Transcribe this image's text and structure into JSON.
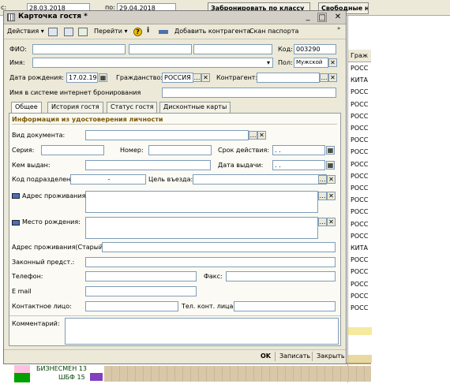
{
  "background": {
    "date_from_label": "с:",
    "date_from": "28.03.2018",
    "date_to_label": "по:",
    "date_to": "29.04.2018",
    "reserve_button": "Забронировать по классу",
    "free_button": "Свободные н",
    "column_header": "Граж",
    "column_values": [
      "РОСС",
      "КИТА",
      "РОСС",
      "РОСС",
      "РОСС",
      "РОСС",
      "РОСС",
      "РОСС",
      "РОСС",
      "РОСС",
      "РОСС",
      "РОСС",
      "РОСС",
      "РОСС",
      "РОСС",
      "КИТА",
      "РОСС",
      "РОСС",
      "РОСС",
      "РОСС",
      "РОСС"
    ],
    "row_businessman": "БИЗНЕСМЕН 13",
    "row_shf": "ШБФ 15"
  },
  "dialog": {
    "title": "Карточка гостя *",
    "toolbar": {
      "actions": "Действия",
      "goto": "Перейти",
      "add_counterparty": "Добавить контрагента",
      "scan_passport": "Скан паспорта"
    },
    "header": {
      "fio_label": "ФИО:",
      "code_label": "Код:",
      "code_value": "003290",
      "name_label": "Имя:",
      "gender_label": "Пол:",
      "gender_value": "Мужской",
      "birth_label": "Дата рождения:",
      "birth_value": "17.02.1965",
      "citizenship_label": "Гражданство:",
      "citizenship_value": "РОССИЯ",
      "counterparty_label": "Контрагент:",
      "internet_label": "Имя в системе интернет бронирования"
    },
    "tabs": [
      "Общее",
      "История гостя",
      "Статус гостя",
      "Дисконтные карты"
    ],
    "general": {
      "section_title": "Информация из удостоверения личности",
      "doc_type_label": "Вид документа:",
      "series_label": "Серия:",
      "number_label": "Номер:",
      "validity_label": "Срок действия:",
      "validity_value": ". .",
      "issued_by_label": "Кем выдан:",
      "issue_date_label": "Дата выдачи:",
      "issue_date_value": ". .",
      "subdivision_label": "Код подразделения:",
      "subdivision_value": "-",
      "purpose_label": "Цель въезда:",
      "residence_label": "Адрес проживания:",
      "birthplace_label": "Место рождения:",
      "old_address_label": "Адрес проживания(Старый):",
      "legal_rep_label": "Законный предст.:",
      "phone_label": "Телефон:",
      "fax_label": "Факс:",
      "email_label": "E mail",
      "contact_label": "Контактное лицо:",
      "contact_phone_label": "Тел. конт. лица:",
      "comment_label": "Комментарий:"
    },
    "buttons": {
      "ok": "OK",
      "save": "Записать",
      "close": "Закрыть"
    }
  }
}
